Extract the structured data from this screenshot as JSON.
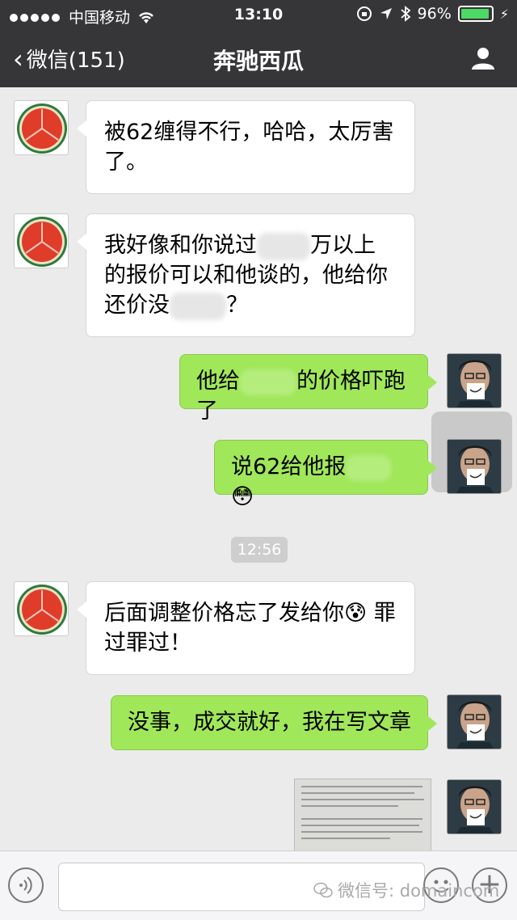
{
  "status_bar": {
    "carrier": "中国移动",
    "time": "13:10",
    "battery": "96%",
    "battery_level": 0.96
  },
  "nav": {
    "back_label": "微信(151)",
    "title": "奔驰西瓜"
  },
  "messages": [
    {
      "side": "left",
      "text": "被62缠得不行，哈哈，太厉害了。"
    },
    {
      "side": "left",
      "text_parts": [
        "我好像和你说过",
        "万以上的报价可以和他谈的，他给你还价没",
        "？"
      ]
    },
    {
      "side": "right",
      "text_parts": [
        "他给",
        "的价格吓跑了"
      ]
    },
    {
      "side": "right",
      "text_parts": [
        "说62给他报",
        "😳"
      ]
    },
    {
      "side": "left",
      "text_parts": [
        "后面调整价格忘了发给你",
        "😰",
        "罪过罪过！"
      ]
    },
    {
      "side": "right",
      "text": "没事，成交就好，我在写文章"
    }
  ],
  "timestamp": "12:56",
  "watermark": "微信号: domaincom",
  "colors": {
    "header_bg": "#363639",
    "chat_bg": "#ebebeb",
    "bubble_sent": "#a0e75a",
    "bubble_received": "#ffffff"
  }
}
